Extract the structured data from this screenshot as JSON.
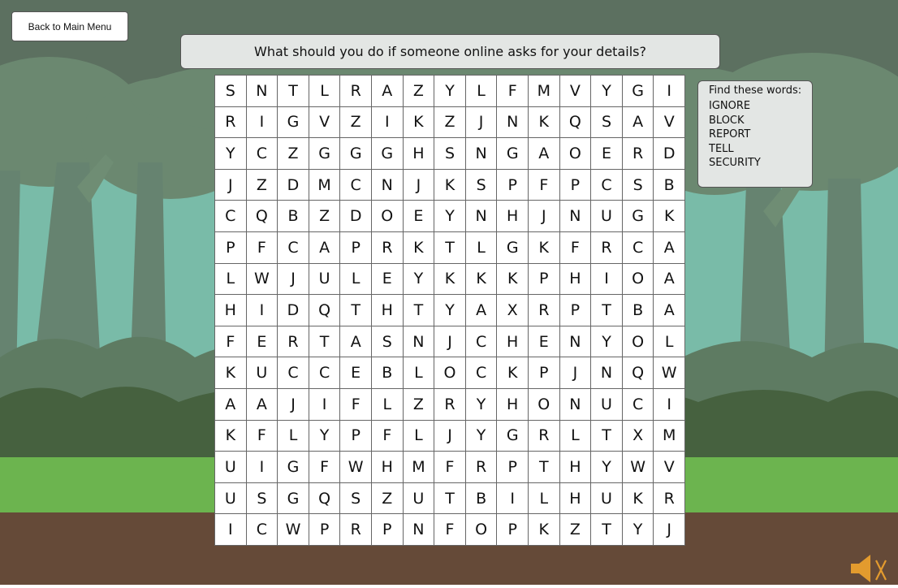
{
  "back_button": "Back to Main Menu",
  "question": "What should you do if someone online asks for your details?",
  "grid": [
    [
      "S",
      "N",
      "T",
      "L",
      "R",
      "A",
      "Z",
      "Y",
      "L",
      "F",
      "M",
      "V",
      "Y",
      "G",
      "I"
    ],
    [
      "R",
      "I",
      "G",
      "V",
      "Z",
      "I",
      "K",
      "Z",
      "J",
      "N",
      "K",
      "Q",
      "S",
      "A",
      "V"
    ],
    [
      "Y",
      "C",
      "Z",
      "G",
      "G",
      "G",
      "H",
      "S",
      "N",
      "G",
      "A",
      "O",
      "E",
      "R",
      "D"
    ],
    [
      "J",
      "Z",
      "D",
      "M",
      "C",
      "N",
      "J",
      "K",
      "S",
      "P",
      "F",
      "P",
      "C",
      "S",
      "B"
    ],
    [
      "C",
      "Q",
      "B",
      "Z",
      "D",
      "O",
      "E",
      "Y",
      "N",
      "H",
      "J",
      "N",
      "U",
      "G",
      "K"
    ],
    [
      "P",
      "F",
      "C",
      "A",
      "P",
      "R",
      "K",
      "T",
      "L",
      "G",
      "K",
      "F",
      "R",
      "C",
      "A"
    ],
    [
      "L",
      "W",
      "J",
      "U",
      "L",
      "E",
      "Y",
      "K",
      "K",
      "K",
      "P",
      "H",
      "I",
      "O",
      "A"
    ],
    [
      "H",
      "I",
      "D",
      "Q",
      "T",
      "H",
      "T",
      "Y",
      "A",
      "X",
      "R",
      "P",
      "T",
      "B",
      "A"
    ],
    [
      "F",
      "E",
      "R",
      "T",
      "A",
      "S",
      "N",
      "J",
      "C",
      "H",
      "E",
      "N",
      "Y",
      "O",
      "L"
    ],
    [
      "K",
      "U",
      "C",
      "C",
      "E",
      "B",
      "L",
      "O",
      "C",
      "K",
      "P",
      "J",
      "N",
      "Q",
      "W"
    ],
    [
      "A",
      "A",
      "J",
      "I",
      "F",
      "L",
      "Z",
      "R",
      "Y",
      "H",
      "O",
      "N",
      "U",
      "C",
      "I"
    ],
    [
      "K",
      "F",
      "L",
      "Y",
      "P",
      "F",
      "L",
      "J",
      "Y",
      "G",
      "R",
      "L",
      "T",
      "X",
      "M"
    ],
    [
      "U",
      "I",
      "G",
      "F",
      "W",
      "H",
      "M",
      "F",
      "R",
      "P",
      "T",
      "H",
      "Y",
      "W",
      "V"
    ],
    [
      "U",
      "S",
      "G",
      "Q",
      "S",
      "Z",
      "U",
      "T",
      "B",
      "I",
      "L",
      "H",
      "U",
      "K",
      "R"
    ],
    [
      "I",
      "C",
      "W",
      "P",
      "R",
      "P",
      "N",
      "F",
      "O",
      "P",
      "K",
      "Z",
      "T",
      "Y",
      "J"
    ]
  ],
  "find_words": {
    "title": "Find these words:",
    "words": [
      "IGNORE",
      "BLOCK",
      "REPORT",
      "TELL",
      "SECURITY"
    ]
  },
  "sound_icon": "speaker-muted-icon",
  "colors": {
    "sky": "#5c7060",
    "trees_back": "#6e8c72",
    "trees_front": "#4e6b52",
    "sky_gap": "#79bba8",
    "grass": "#6cb44f",
    "dirt": "#654a38",
    "speaker": "#e39b2e"
  }
}
